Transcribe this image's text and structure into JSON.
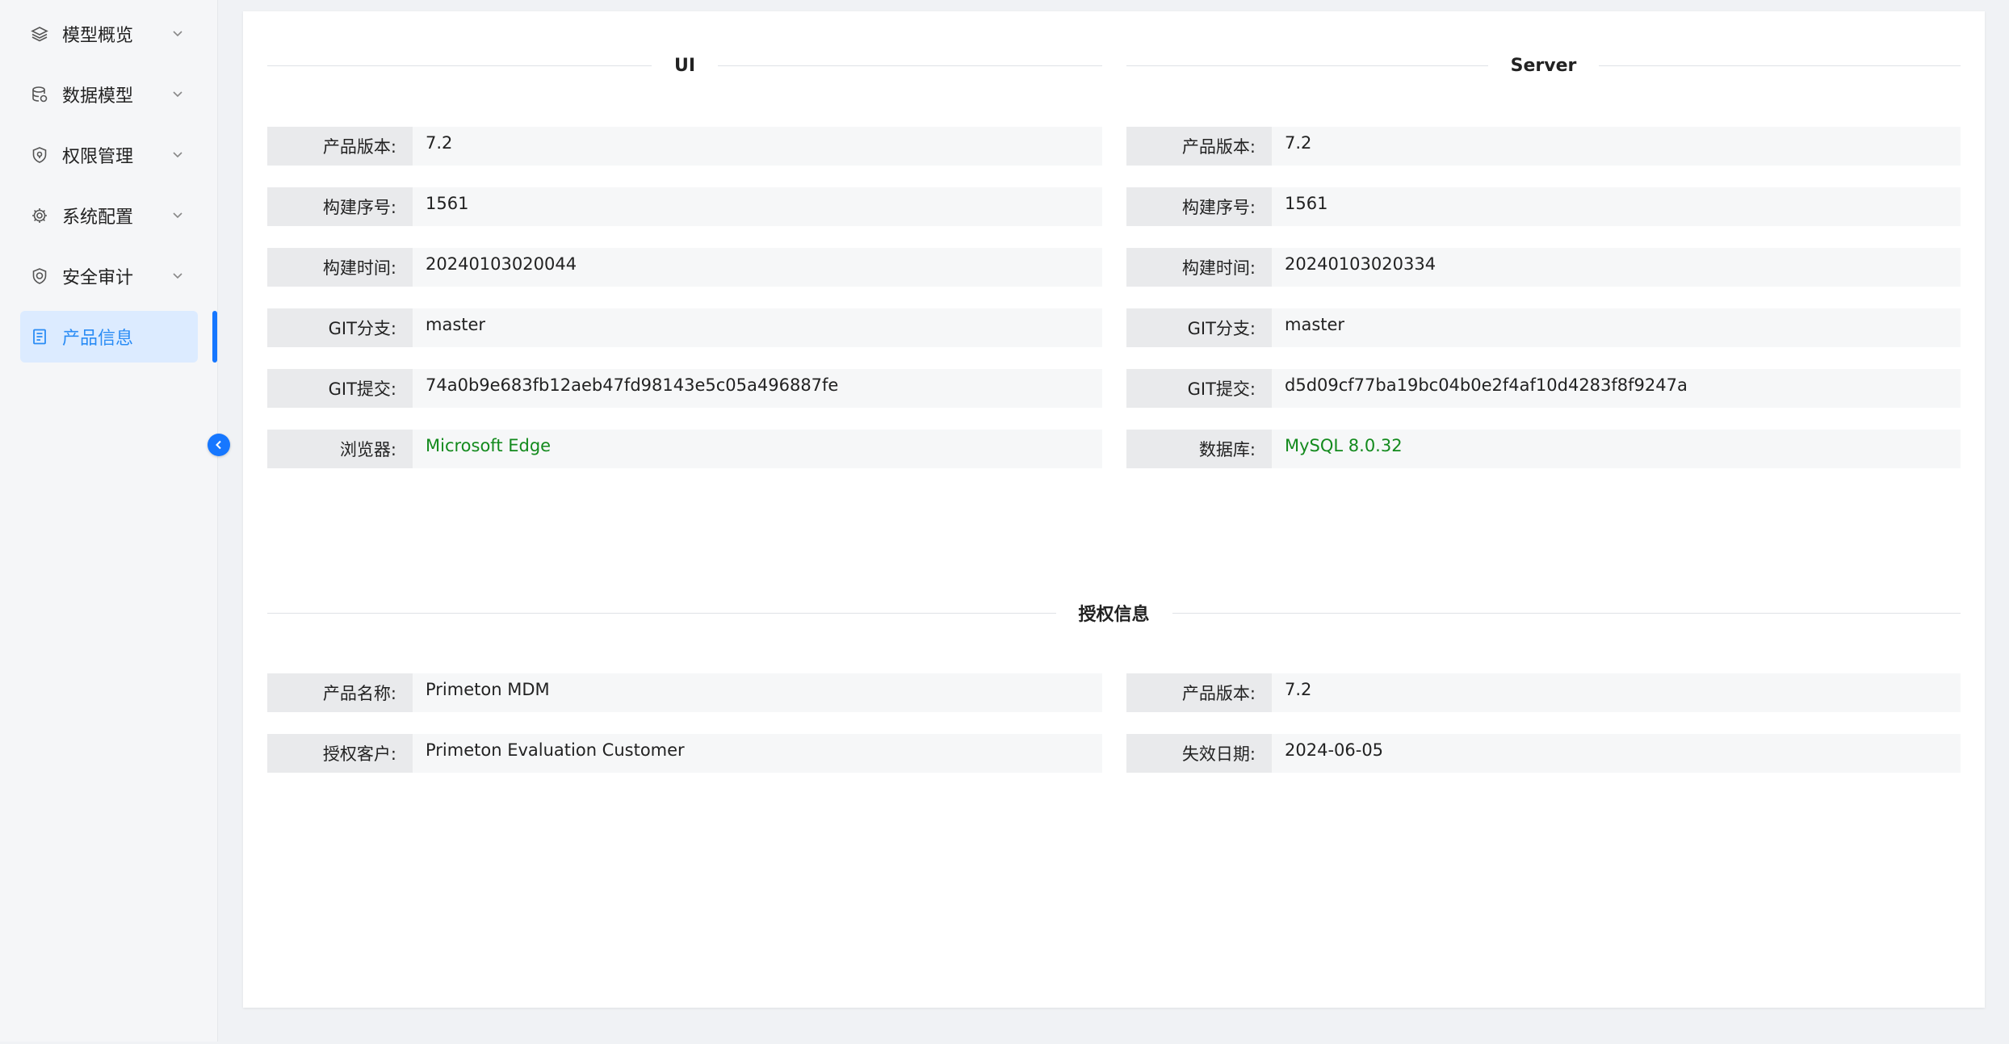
{
  "sidebar": {
    "items": [
      {
        "label": "模型概览",
        "icon": "layers-icon"
      },
      {
        "label": "数据模型",
        "icon": "database-icon"
      },
      {
        "label": "权限管理",
        "icon": "shield-icon"
      },
      {
        "label": "系统配置",
        "icon": "gear-icon"
      },
      {
        "label": "安全审计",
        "icon": "shield-check-icon"
      },
      {
        "label": "产品信息",
        "icon": "document-icon"
      }
    ],
    "active_index": 5
  },
  "sections": {
    "ui": {
      "title": "UI",
      "rows": [
        {
          "key": "产品版本:",
          "value": "7.2"
        },
        {
          "key": "构建序号:",
          "value": "1561"
        },
        {
          "key": "构建时间:",
          "value": "20240103020044"
        },
        {
          "key": "GIT分支:",
          "value": "master"
        },
        {
          "key": "GIT提交:",
          "value": "74a0b9e683fb12aeb47fd98143e5c05a496887fe"
        },
        {
          "key": "浏览器:",
          "value": "Microsoft Edge"
        }
      ]
    },
    "server": {
      "title": "Server",
      "rows": [
        {
          "key": "产品版本:",
          "value": "7.2"
        },
        {
          "key": "构建序号:",
          "value": "1561"
        },
        {
          "key": "构建时间:",
          "value": "20240103020334"
        },
        {
          "key": "GIT分支:",
          "value": "master"
        },
        {
          "key": "GIT提交:",
          "value": "d5d09cf77ba19bc04b0e2f4af10d4283f8f9247a"
        },
        {
          "key": "数据库:",
          "value": "MySQL 8.0.32"
        }
      ]
    },
    "license": {
      "title": "授权信息",
      "left": [
        {
          "key": "产品名称:",
          "value": "Primeton MDM"
        },
        {
          "key": "授权客户:",
          "value": "Primeton Evaluation Customer"
        }
      ],
      "right": [
        {
          "key": "产品版本:",
          "value": "7.2"
        },
        {
          "key": "失效日期:",
          "value": "2024-06-05"
        }
      ]
    }
  },
  "colors": {
    "accent": "#1677ff",
    "highlight_value": "#138a1d",
    "active_bg": "#dcebff"
  }
}
